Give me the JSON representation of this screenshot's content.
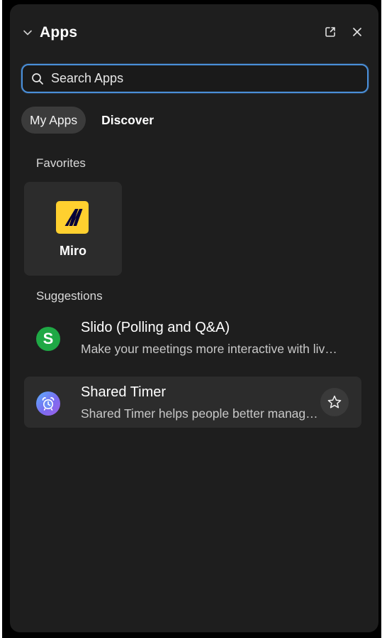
{
  "header": {
    "title": "Apps"
  },
  "search": {
    "placeholder": "Search Apps",
    "value": ""
  },
  "tabs": [
    {
      "label": "My Apps",
      "active": true
    },
    {
      "label": "Discover",
      "active": false
    }
  ],
  "favorites": {
    "label": "Favorites",
    "items": [
      {
        "name": "Miro",
        "icon": "miro-logo-icon",
        "color": "#ffd02f"
      }
    ]
  },
  "suggestions": {
    "label": "Suggestions",
    "items": [
      {
        "name": "Slido (Polling and Q&A)",
        "description": "Make your meetings more interactive with live polls and Q&A",
        "icon_letter": "S",
        "icon": "slido-icon",
        "color": "#1fa845"
      },
      {
        "name": "Shared Timer",
        "description": "Shared Timer helps people better manage their time",
        "icon": "alarm-clock-icon",
        "favorite_action_icon": "star-icon"
      }
    ]
  },
  "colors": {
    "panel_bg": "#1e1e1e",
    "accent": "#4a8fd9",
    "tile_bg": "#2c2c2c"
  }
}
